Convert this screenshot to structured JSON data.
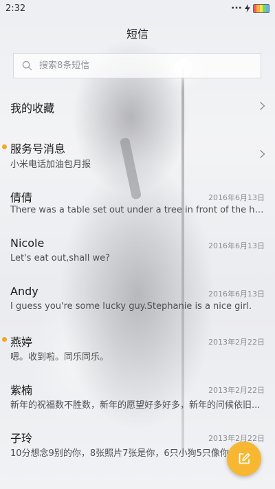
{
  "status_bar": {
    "time": "2:32",
    "signal_icon": "signal-dots-icon",
    "charging_icon": "charging-bolt-icon",
    "battery_icon": "battery-icon"
  },
  "header": {
    "title": "短信"
  },
  "search": {
    "placeholder": "搜索8条短信",
    "value": "",
    "icon": "search-icon"
  },
  "favorites": {
    "title": "我的收藏",
    "icon": "chevron-right-icon"
  },
  "service": {
    "title": "服务号消息",
    "subtitle": "小米电话加油包月报",
    "unread": true,
    "icon": "chevron-right-icon"
  },
  "conversations": [
    {
      "name": "倩倩",
      "date": "2016年6月13日",
      "preview": "There was a table set out under a tree in front of the hous",
      "unread": false
    },
    {
      "name": "Nicole",
      "date": "2016年6月13日",
      "preview": "Let's eat out,shall we?",
      "unread": false
    },
    {
      "name": "Andy",
      "date": "2016年6月13日",
      "preview": "I guess you're some lucky guy.Stephanie is a nice girl.",
      "unread": false
    },
    {
      "name": "燕婷",
      "date": "2013年2月22日",
      "preview": "嗯。收到啦。同乐同乐。",
      "unread": true
    },
    {
      "name": "紫楠",
      "date": "2013年2月22日",
      "preview": "新年的祝福数不胜数，新年的愿望好多好多，新年的问候依旧...",
      "unread": false
    },
    {
      "name": "子玲",
      "date": "2013年2月22日",
      "preview": "10分想念9别的你，8张照片7张是你，6只小狗5只像你，",
      "unread": false
    }
  ],
  "fab": {
    "icon": "compose-icon"
  },
  "colors": {
    "accent": "#f8b731",
    "unread_dot": "#f5a623"
  }
}
